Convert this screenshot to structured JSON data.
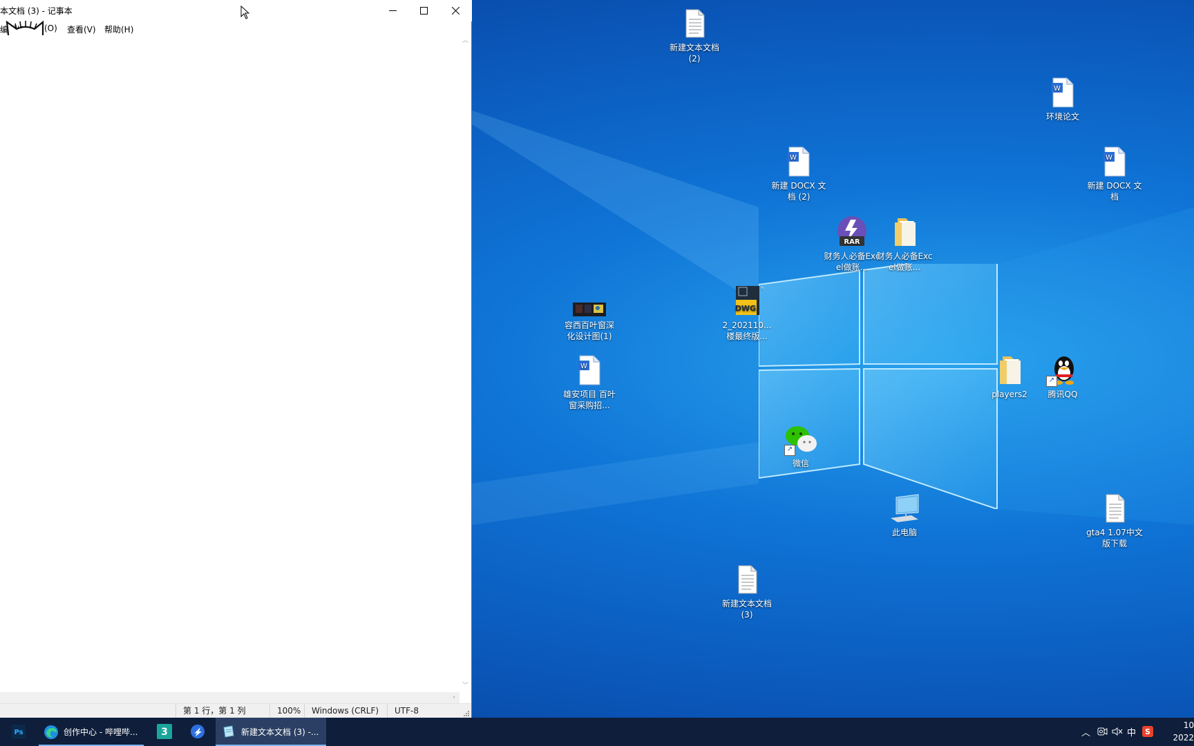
{
  "notepad": {
    "title": "本文档 (3) - 记事本",
    "menus": [
      "编辑(E)",
      "(O)",
      "查看(V)",
      "帮助(H)"
    ],
    "status": {
      "position": "第 1 行，第 1 列",
      "zoom": "100%",
      "line_ending": "Windows (CRLF)",
      "encoding": "UTF-8"
    }
  },
  "desktop_icons": [
    {
      "label": "新建文本文档 (2)",
      "icon": "text-file-icon"
    },
    {
      "label": "环境论文",
      "icon": "word-doc-icon"
    },
    {
      "label": "新建 DOCX 文档 (2)",
      "icon": "word-doc-icon"
    },
    {
      "label": "新建 DOCX 文档",
      "icon": "word-doc-icon"
    },
    {
      "label": "财务人必备Excel做账...",
      "icon": "rar-archive-icon"
    },
    {
      "label": "财务人必备Excel做账...",
      "icon": "folder-icon"
    },
    {
      "label": "容西百叶窗深化设计图(1)",
      "icon": "image-thumbnail-icon"
    },
    {
      "label": "2_202110...楼最终版...",
      "icon": "dwg-file-icon"
    },
    {
      "label": "雄安项目 百叶窗采购招...",
      "icon": "word-doc-icon"
    },
    {
      "label": "players2",
      "icon": "folder-icon"
    },
    {
      "label": "腾讯QQ",
      "icon": "qq-icon"
    },
    {
      "label": "微信",
      "icon": "wechat-icon"
    },
    {
      "label": "此电脑",
      "icon": "computer-icon"
    },
    {
      "label": "gta4 1.07中文版下载",
      "icon": "text-file-icon"
    },
    {
      "label": "新建文本文档 (3)",
      "icon": "text-file-icon"
    }
  ],
  "taskbar": {
    "items": [
      {
        "label": "",
        "icon": "photoshop-icon"
      },
      {
        "label": "创作中心 - 哔哩哔...",
        "icon": "edge-icon"
      },
      {
        "label": "",
        "icon": "3dsmax-icon"
      },
      {
        "label": "",
        "icon": "feishu-icon"
      },
      {
        "label": "新建文本文档 (3) -...",
        "icon": "notepad-icon"
      }
    ],
    "tray": {
      "ime": "中",
      "clock_time": "10",
      "clock_date": "2022"
    }
  },
  "colors": {
    "wallpaper": "#0f74d6",
    "taskbar": "#0f1e3a",
    "taskbar_active": "#2a3f63"
  }
}
